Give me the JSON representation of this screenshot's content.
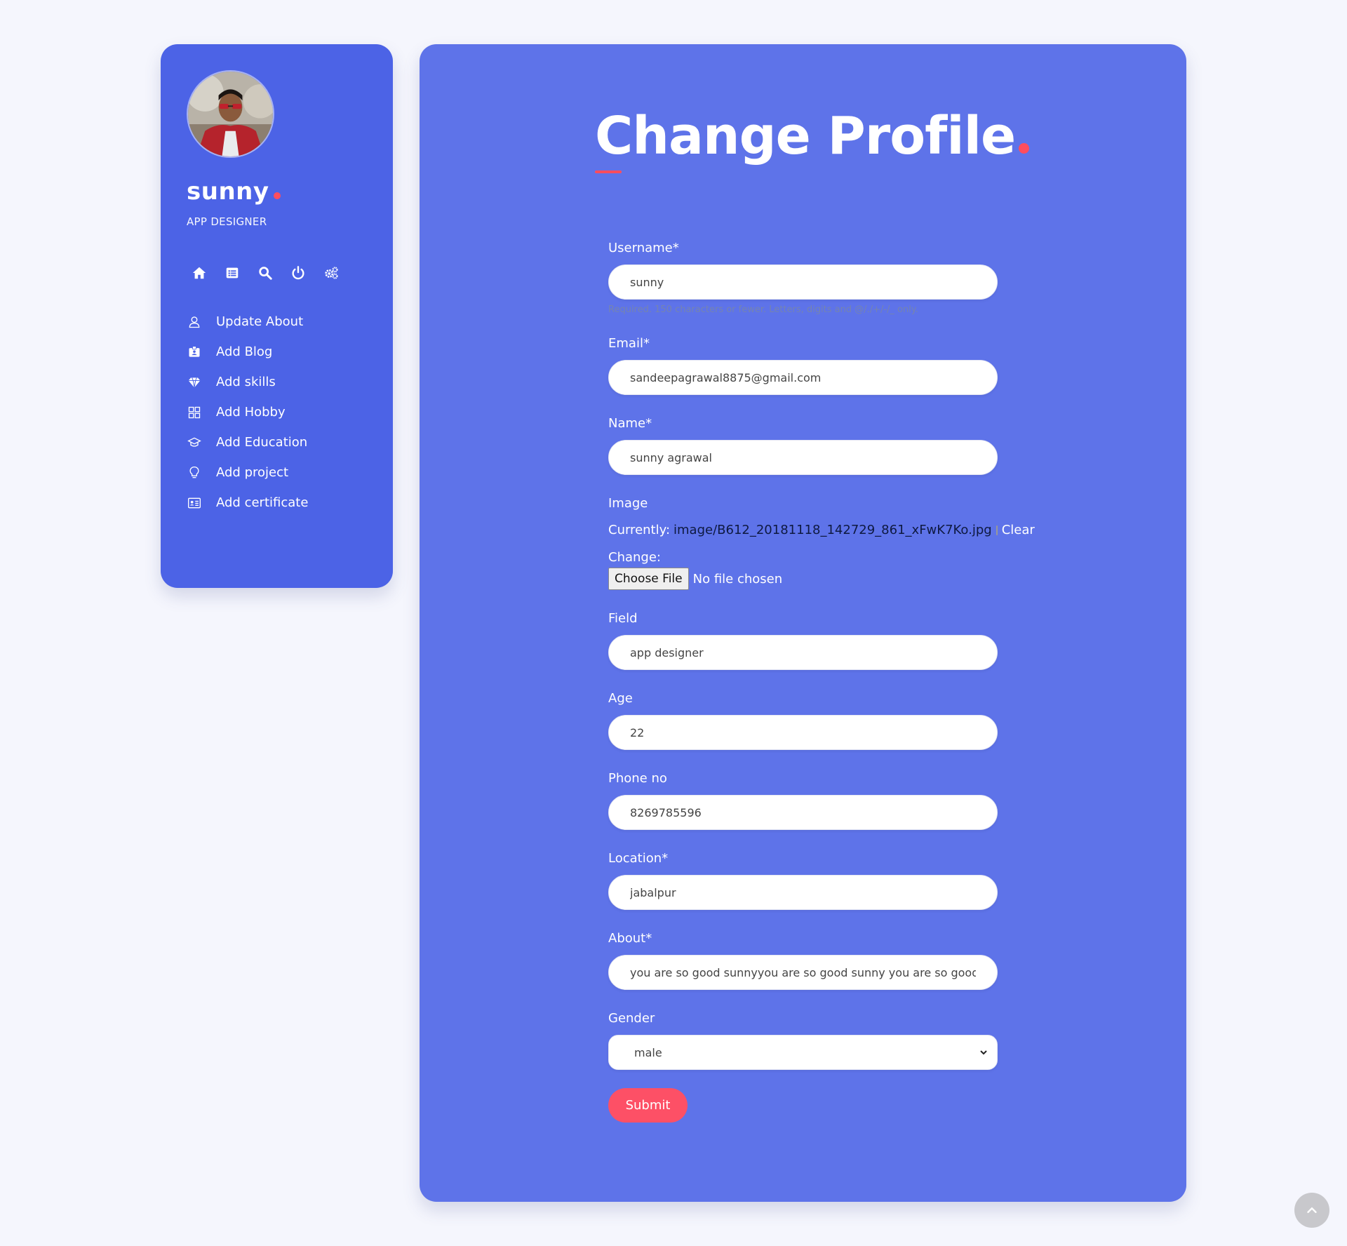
{
  "sidebar": {
    "name": "sunny",
    "role": "APP DESIGNER",
    "icons": [
      "home-icon",
      "list-icon",
      "search-icon",
      "power-icon",
      "settings-icon"
    ],
    "menu": [
      {
        "label": "Update About",
        "icon": "user-icon"
      },
      {
        "label": "Add Blog",
        "icon": "blog-badge-icon"
      },
      {
        "label": "Add skills",
        "icon": "diamond-icon"
      },
      {
        "label": "Add Hobby",
        "icon": "grid-icon"
      },
      {
        "label": "Add Education",
        "icon": "graduation-cap-icon"
      },
      {
        "label": "Add project",
        "icon": "lightbulb-icon"
      },
      {
        "label": "Add certificate",
        "icon": "id-card-icon"
      }
    ]
  },
  "main": {
    "title": "Change Profile",
    "form": {
      "username": {
        "label": "Username*",
        "value": "sunny",
        "help": "Required. 150 characters or fewer. Letters, digits and @/./+/-/_ only."
      },
      "email": {
        "label": "Email*",
        "value": "sandeepagrawal8875@gmail.com"
      },
      "name": {
        "label": "Name*",
        "value": "sunny agrawal"
      },
      "image": {
        "label": "Image",
        "currently_label": "Currently:",
        "current_file": "image/B612_20181118_142729_861_xFwK7Ko.jpg",
        "clear_label": "Clear",
        "change_label": "Change:",
        "choose_button": "Choose File",
        "file_status": "No file chosen"
      },
      "field": {
        "label": "Field",
        "value": "app designer"
      },
      "age": {
        "label": "Age",
        "value": "22"
      },
      "phone": {
        "label": "Phone no",
        "value": "8269785596"
      },
      "location": {
        "label": "Location*",
        "value": "jabalpur"
      },
      "about": {
        "label": "About*",
        "value": "you are so good sunnyyou are so good sunny you are so good sunny"
      },
      "gender": {
        "label": "Gender",
        "value": "male"
      },
      "submit": "Submit"
    }
  },
  "colors": {
    "page_bg": "#f5f6fd",
    "sidebar_bg": "#4c63e6",
    "main_bg": "#5e73e9",
    "accent": "#fd5066"
  }
}
